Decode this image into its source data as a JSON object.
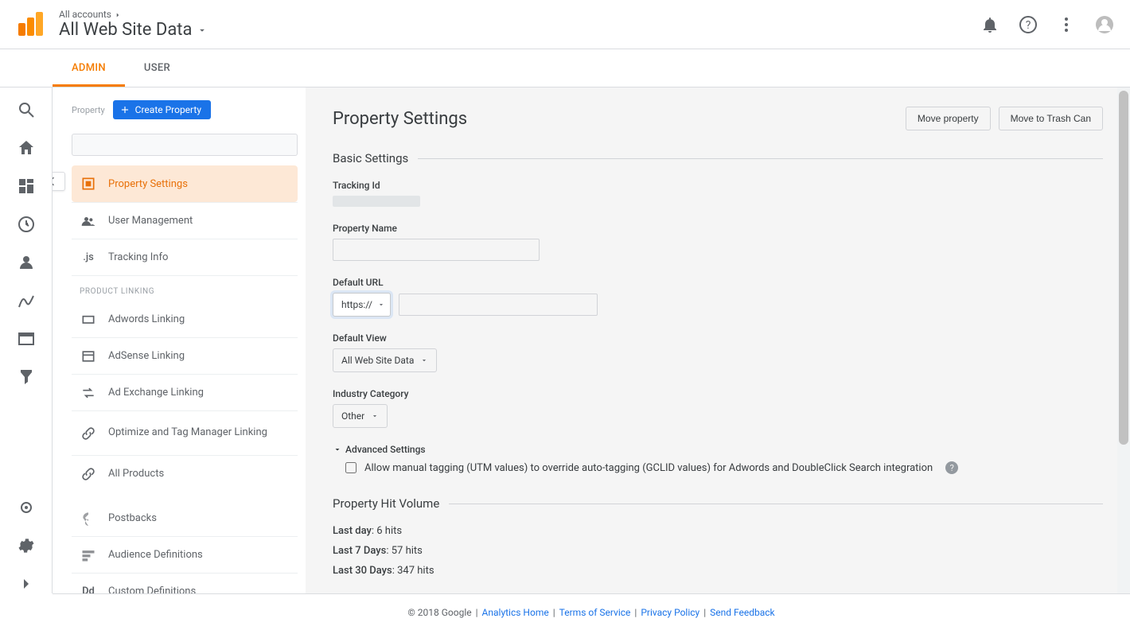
{
  "header": {
    "breadcrumb": "All accounts",
    "title": "All Web Site Data"
  },
  "tabs": {
    "admin": "ADMIN",
    "user": "USER"
  },
  "sidebar": {
    "property_label": "Property",
    "create_property": "Create Property",
    "items": [
      {
        "label": "Property Settings"
      },
      {
        "label": "User Management"
      },
      {
        "label": "Tracking Info"
      }
    ],
    "product_section": "PRODUCT LINKING",
    "product_items": [
      {
        "label": "Adwords Linking"
      },
      {
        "label": "AdSense Linking"
      },
      {
        "label": "Ad Exchange Linking"
      },
      {
        "label": "Optimize and Tag Manager Linking"
      },
      {
        "label": "All Products"
      }
    ],
    "extra_items": [
      {
        "label": "Postbacks"
      },
      {
        "label": "Audience Definitions"
      },
      {
        "label": "Custom Definitions"
      }
    ]
  },
  "main": {
    "title": "Property Settings",
    "move_property": "Move property",
    "move_to_trash": "Move to Trash Can",
    "basic_legend": "Basic Settings",
    "tracking_id_label": "Tracking Id",
    "property_name_label": "Property Name",
    "default_url_label": "Default URL",
    "protocol_value": "https://",
    "default_view_label": "Default View",
    "default_view_value": "All Web Site Data",
    "industry_category_label": "Industry Category",
    "industry_category_value": "Other",
    "advanced_settings": "Advanced Settings",
    "allow_manual_tagging": "Allow manual tagging (UTM values) to override auto-tagging (GCLID values) for Adwords and DoubleClick Search integration",
    "hit_legend": "Property Hit Volume",
    "hits": {
      "last_day_label": "Last day",
      "last_day_value": ": 6 hits",
      "last_7_label": "Last 7 Days",
      "last_7_value": ": 57 hits",
      "last_30_label": "Last 30 Days",
      "last_30_value": ": 347 hits"
    }
  },
  "footer": {
    "copyright": "© 2018 Google",
    "analytics_home": "Analytics Home",
    "terms": "Terms of Service",
    "privacy": "Privacy Policy",
    "feedback": "Send Feedback",
    "sep": " | "
  }
}
